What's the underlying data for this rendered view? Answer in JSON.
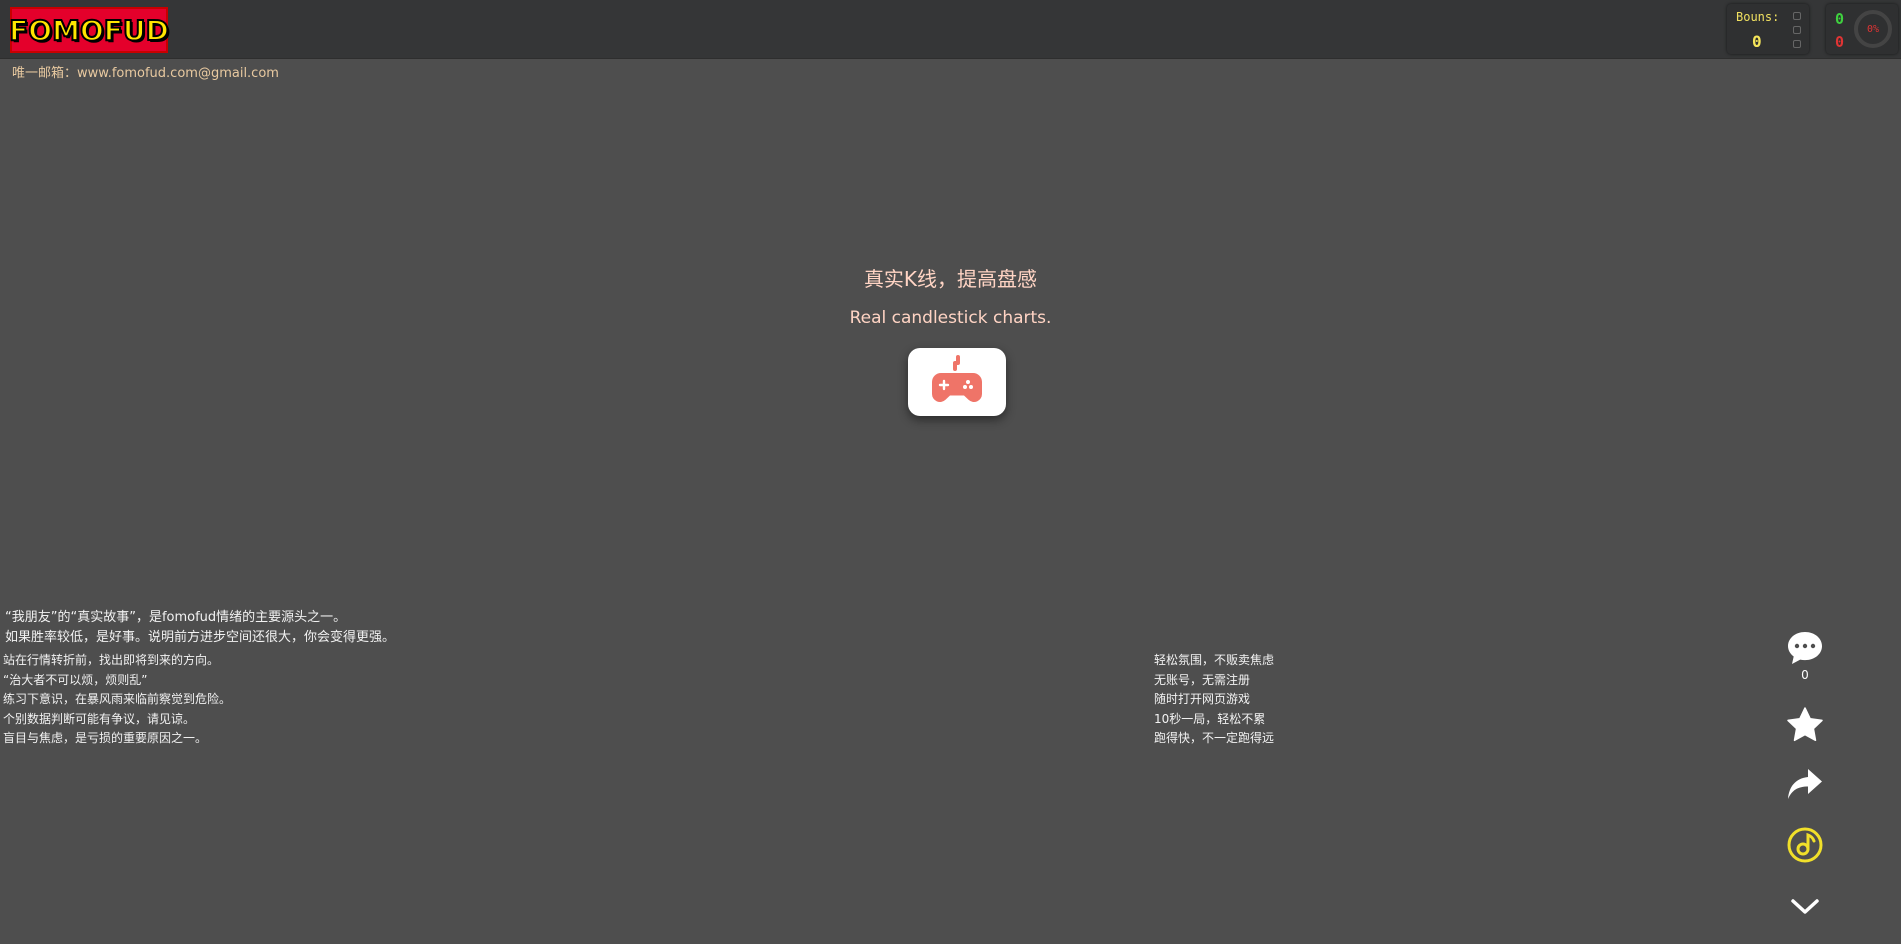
{
  "header": {
    "logo_text": "FOMOFUD",
    "bonus_label": "Bouns:",
    "bonus_value": "0",
    "score_up": "0",
    "score_down": "0",
    "gauge_text": "0%"
  },
  "contact": {
    "email_line": "唯一邮箱：www.fomofud.com@gmail.com"
  },
  "hero": {
    "title_cn": "真实K线，提高盘感",
    "title_en": "Real candlestick charts."
  },
  "quotes_top": [
    "“我朋友”的“真实故事”，是fomofud情绪的主要源头之一。",
    "如果胜率较低，是好事。说明前方进步空间还很大，你会变得更强。"
  ],
  "quotes_bottom": [
    "站在行情转折前，找出即将到来的方向。",
    "“治大者不可以烦，烦则乱”",
    "练习下意识，在暴风雨来临前察觉到危险。",
    "个别数据判断可能有争议，请见谅。",
    "盲目与焦虑，是亏损的重要原因之一。"
  ],
  "features": [
    "轻松氛围，不贩卖焦虑",
    "无账号，无需注册",
    "随时打开网页游戏",
    "10秒一局，轻松不累",
    "跑得快，不一定跑得远"
  ],
  "rail": {
    "comment_count": "0"
  },
  "colors": {
    "background": "#4e4e4e",
    "topbar": "#353637",
    "logo_red": "#e4002b",
    "logo_yellow": "#ffe600",
    "accent_salmon": "#ef7468",
    "music_yellow": "#f1e02a",
    "up_green": "#3fd13f",
    "down_red": "#e03434"
  }
}
